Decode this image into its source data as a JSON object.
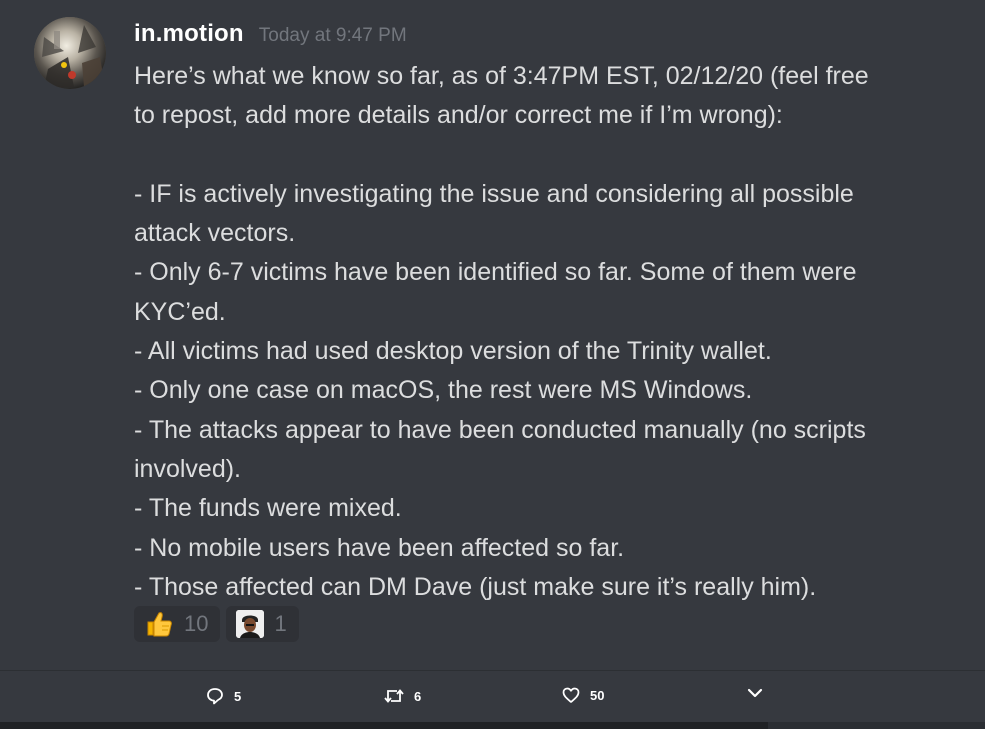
{
  "message": {
    "username": "in.motion",
    "timestamp": "Today at 9:47 PM",
    "lines": [
      "Here’s what we know so far, as of 3:47PM EST, 02/12/20 (feel free",
      "to repost, add more details and/or correct me if I’m wrong):",
      "",
      "- IF is actively investigating the issue and considering all possible",
      "attack vectors.",
      "- Only 6-7 victims have been identified so far. Some of them were",
      "KYC’ed.",
      "- All victims had used desktop version of the Trinity wallet.",
      "- Only one case on macOS, the rest were MS Windows.",
      "- The attacks appear to have been conducted manually (no scripts",
      "involved).",
      "- The funds were mixed.",
      "- No mobile users have been affected so far.",
      "- Those affected can DM Dave (just make sure it’s really him)."
    ]
  },
  "reactions": [
    {
      "emoji": "thumbs-up-icon",
      "count": "10"
    },
    {
      "emoji": "custom-emoji-icon",
      "count": "1"
    }
  ],
  "actions": {
    "reply_count": "5",
    "retweet_count": "6",
    "like_count": "50"
  },
  "colors": {
    "background": "#36393f",
    "username": "#ffffff",
    "timestamp": "#72767d",
    "text": "#dcddde",
    "reaction_bg": "#2f3136"
  }
}
